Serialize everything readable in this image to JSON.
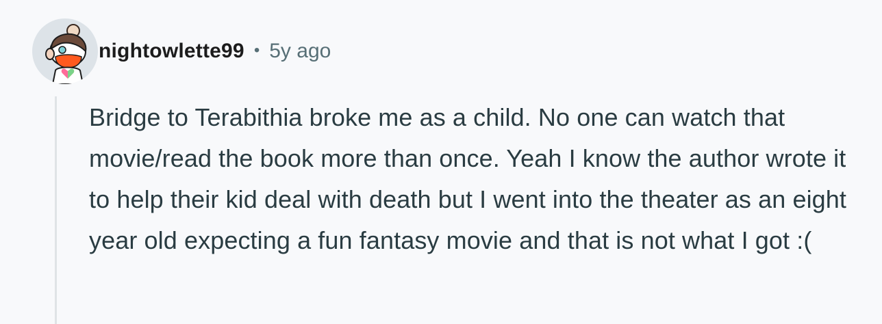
{
  "comment": {
    "username": "nightowlette99",
    "separator": "•",
    "timestamp": "5y ago",
    "avatar_icon": "snoo-avatar-icon",
    "body": "Bridge to Terabithia broke me as a child. No one can watch that movie/read the book more than once. Yeah I know the author wrote it to help their kid deal with death but I went into the theater as an eight year old expecting a fun fantasy movie and that is not what I got :("
  },
  "colors": {
    "background": "#f8f9fb",
    "username": "#1c1c1c",
    "meta": "#576f76",
    "body_text": "#2a3c42",
    "thread_line": "#dfe3e6"
  }
}
